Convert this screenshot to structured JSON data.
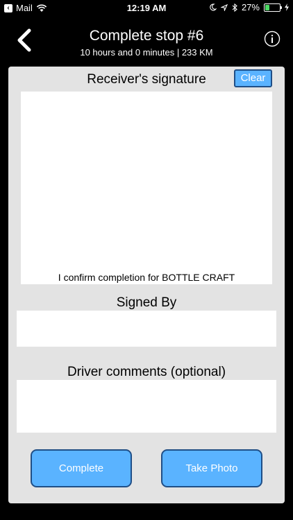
{
  "status_bar": {
    "back_app": "Mail",
    "time": "12:19 AM",
    "battery": "27%",
    "battery_level": 0.27,
    "icons": [
      "wifi-icon",
      "moon-icon",
      "location-icon",
      "bluetooth-icon",
      "battery-icon",
      "charging-icon"
    ]
  },
  "header": {
    "title": "Complete stop #6",
    "subtitle": "10 hours and 0 minutes | 233 KM",
    "icons": [
      "chevron-left-icon",
      "info-icon"
    ]
  },
  "signature": {
    "title": "Receiver's signature",
    "clear_label": "Clear",
    "confirm_text": "I confirm completion for BOTTLE CRAFT"
  },
  "signed_by": {
    "label": "Signed By",
    "value": ""
  },
  "comments": {
    "label": "Driver comments (optional)",
    "value": ""
  },
  "actions": {
    "complete_label": "Complete",
    "photo_label": "Take Photo"
  },
  "colors": {
    "background": "#000000",
    "card": "#e3e3e3",
    "button": "#5ab3ff",
    "button_border": "#1f4e86",
    "battery_fill": "#4cd964"
  }
}
